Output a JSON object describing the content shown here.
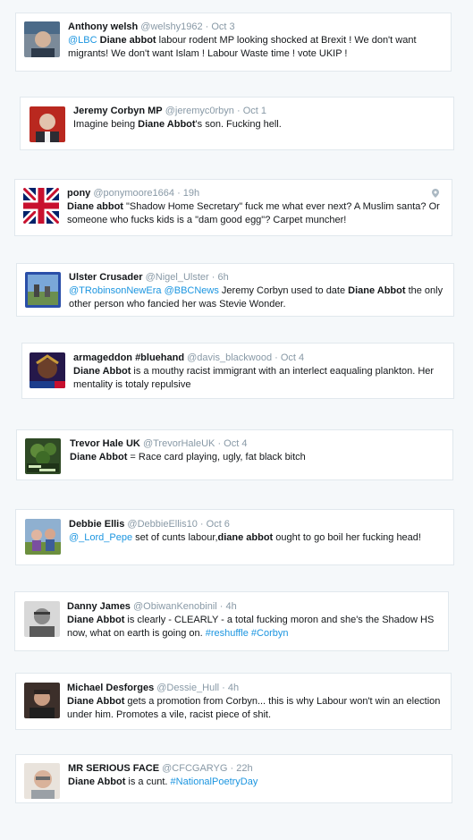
{
  "tweets": [
    {
      "name": "Anthony welsh",
      "handle": "@welshy1962",
      "time": "Oct 3",
      "parts": [
        {
          "t": "@LBC",
          "s": "link"
        },
        {
          "t": " "
        },
        {
          "t": "Diane abbot",
          "s": "bold"
        },
        {
          "t": " labour rodent MP looking shocked at Brexit ! We don't want migrants! We don't want Islam ! Labour Waste time ! vote UKIP !"
        }
      ]
    },
    {
      "name": "Jeremy Corbyn MP",
      "handle": "@jeremyc0rbyn",
      "time": "Oct 1",
      "parts": [
        {
          "t": "Imagine being "
        },
        {
          "t": "Diane Abbot",
          "s": "bold"
        },
        {
          "t": "'s son. Fucking hell."
        }
      ]
    },
    {
      "name": "pony",
      "handle": "@ponymoore1664",
      "time": "19h",
      "parts": [
        {
          "t": "Diane abbot",
          "s": "bold"
        },
        {
          "t": " \"Shadow Home Secretary\" fuck me what ever next? A Muslim santa? Or someone who fucks kids is a \"dam good egg\"? Carpet muncher!"
        }
      ]
    },
    {
      "name": "Ulster Crusader",
      "handle": "@Nigel_Ulster",
      "time": "6h",
      "parts": [
        {
          "t": "@TRobinsonNewEra",
          "s": "link"
        },
        {
          "t": " "
        },
        {
          "t": "@BBCNews",
          "s": "link"
        },
        {
          "t": " Jeremy Corbyn used to date "
        },
        {
          "t": "Diane Abbot",
          "s": "bold"
        },
        {
          "t": " the only other person who  fancied her was Stevie Wonder."
        }
      ]
    },
    {
      "name": "armageddon #bluehand",
      "handle": "@davis_blackwood",
      "time": "Oct 4",
      "parts": [
        {
          "t": "Diane Abbot",
          "s": "bold"
        },
        {
          "t": " is a mouthy racist immigrant with an interlect eaqualing plankton. Her mentality is totaly repulsive"
        }
      ]
    },
    {
      "name": "Trevor Hale UK",
      "handle": "@TrevorHaleUK",
      "time": "Oct 4",
      "parts": [
        {
          "t": "Diane Abbot",
          "s": "bold"
        },
        {
          "t": " = Race card playing, ugly, fat black bitch"
        }
      ]
    },
    {
      "name": "Debbie Ellis",
      "handle": "@DebbieEllis10",
      "time": "Oct 6",
      "parts": [
        {
          "t": "@_Lord_Pepe",
          "s": "link"
        },
        {
          "t": " set of cunts labour,"
        },
        {
          "t": "diane abbot",
          "s": "bold"
        },
        {
          "t": " ought to go boil her fucking head!"
        }
      ]
    },
    {
      "name": "Danny James",
      "handle": "@ObiwanKenobinil",
      "time": "4h",
      "parts": [
        {
          "t": "Diane Abbot",
          "s": "bold"
        },
        {
          "t": " is clearly - CLEARLY - a total fucking moron and she's the Shadow HS now, what on earth is going on. "
        },
        {
          "t": "#reshuffle",
          "s": "link"
        },
        {
          "t": " "
        },
        {
          "t": "#Corbyn",
          "s": "link"
        }
      ]
    },
    {
      "name": "Michael Desforges",
      "handle": "@Dessie_Hull",
      "time": "4h",
      "parts": [
        {
          "t": "Diane Abbot",
          "s": "bold"
        },
        {
          "t": " gets a promotion from Corbyn... this is why Labour won't win an election under him. Promotes a vile, racist piece of shit."
        }
      ]
    },
    {
      "name": "MR SERIOUS FACE",
      "handle": "@CFCGARYG",
      "time": "22h",
      "parts": [
        {
          "t": "Diane Abbot",
          "s": "bold"
        },
        {
          "t": " is a cunt. "
        },
        {
          "t": "#NationalPoetryDay",
          "s": "link"
        }
      ]
    }
  ],
  "separator": " · ",
  "colors": {
    "link": "#1b95e0",
    "name": "#14171a",
    "meta": "#8899a6",
    "border": "#e1e8ed",
    "background": "#f5f8fa"
  }
}
